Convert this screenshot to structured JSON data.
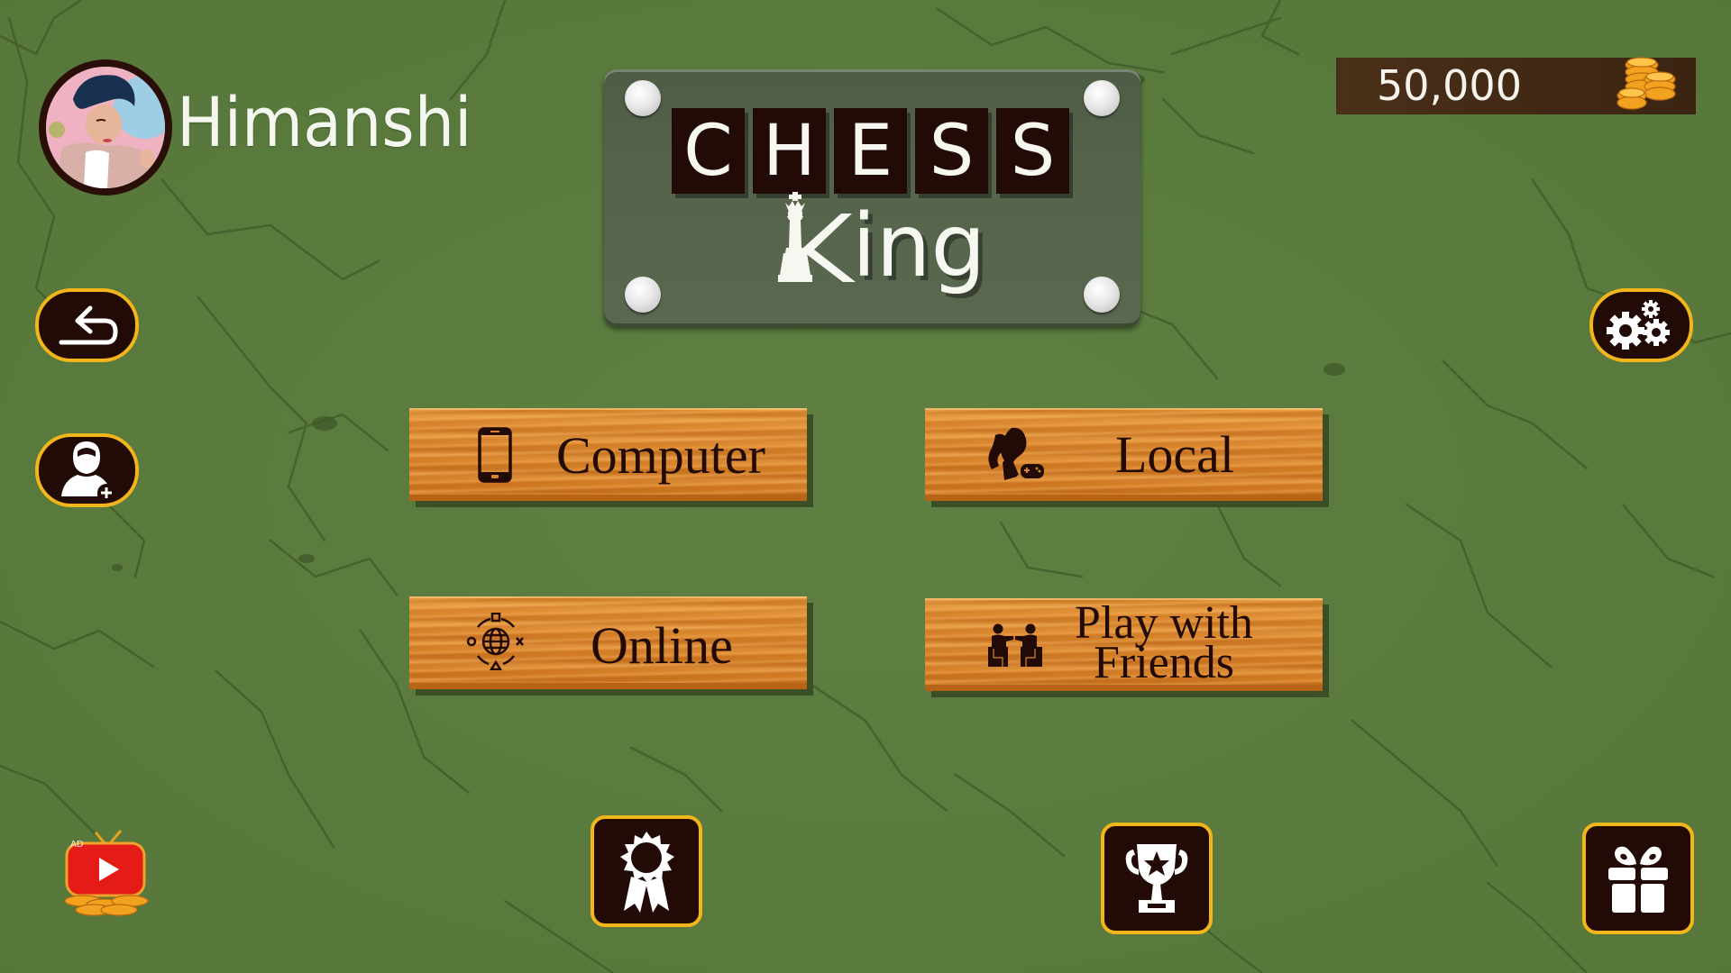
{
  "profile": {
    "player_name": "Himanshi",
    "avatar_icon": "profile-photo"
  },
  "logo": {
    "title_letters": [
      "C",
      "H",
      "E",
      "S",
      "S"
    ],
    "subtitle": "ing",
    "subtitle_full": "King",
    "subtitle_icon": "chess-king-icon"
  },
  "coins": {
    "value": "50,000",
    "icon": "coin-stack-icon"
  },
  "side_buttons": {
    "back_icon": "undo-arrow-icon",
    "add_friend_icon": "add-user-icon",
    "settings_icon": "gears-icon"
  },
  "modes": [
    {
      "label": "Computer",
      "icon": "smartphone-icon"
    },
    {
      "label": "Local",
      "icon": "local-players-gamepad-icon"
    },
    {
      "label": "Online",
      "icon": "globe-network-icon"
    },
    {
      "label_line1": "Play with",
      "label_line2": "Friends",
      "icon": "friends-table-icon"
    }
  ],
  "bottom_bar": {
    "ad_label": "AD",
    "ad_icon": "video-ad-tv-icon",
    "achievements_icon": "award-ribbon-icon",
    "leaderboard_icon": "trophy-star-icon",
    "gift_icon": "gift-box-icon"
  },
  "colors": {
    "background": "#5b7b3f",
    "button_dark": "#220b06",
    "button_border": "#f2b51b",
    "wood": "#d9842a",
    "coin_box": "#4b3019",
    "text_light": "#f6f3ec"
  }
}
